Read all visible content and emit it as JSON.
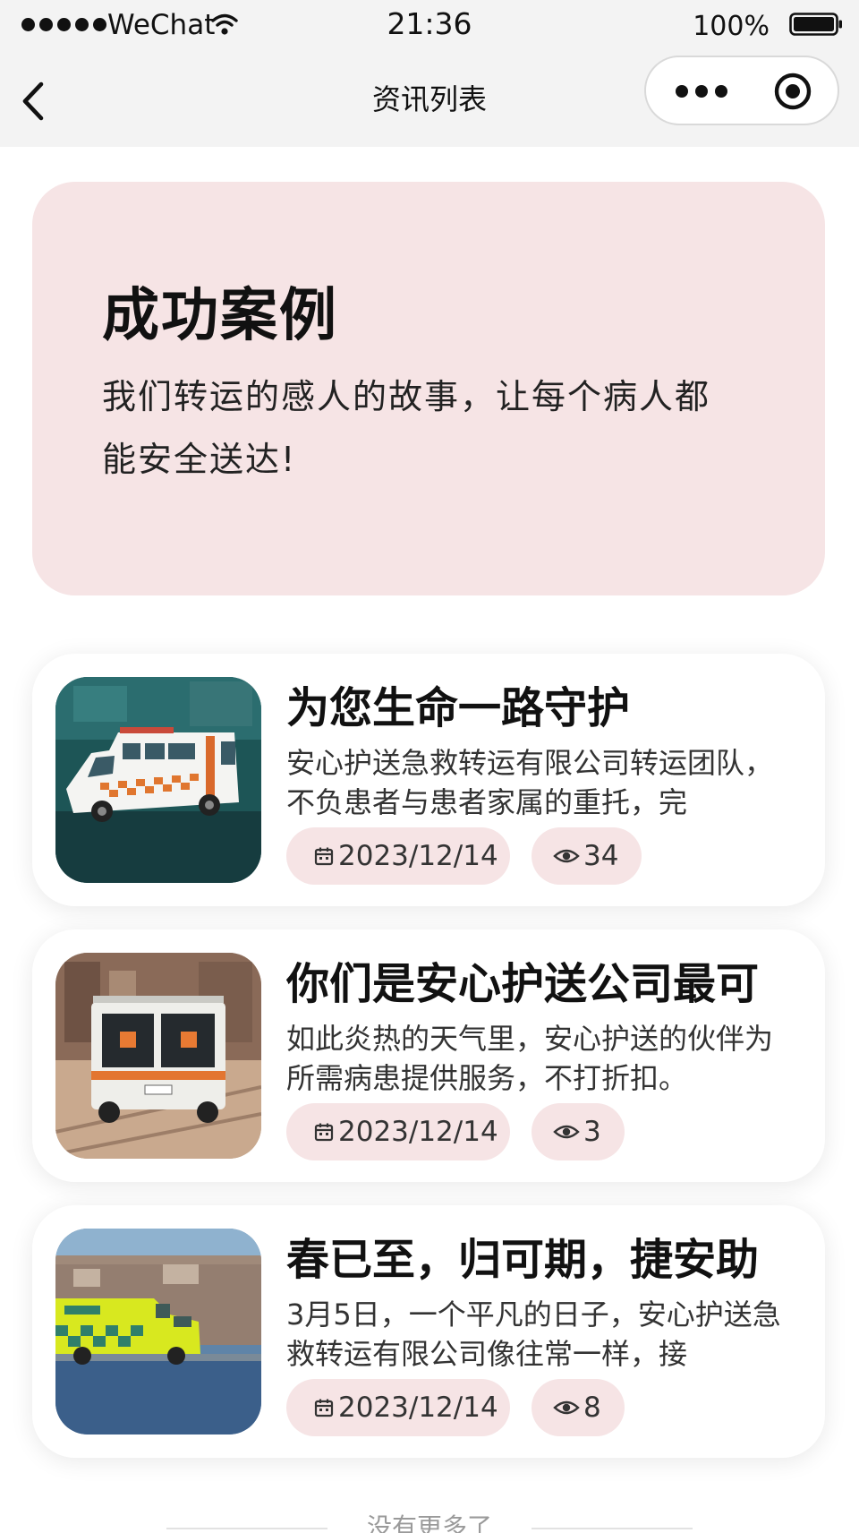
{
  "status_bar": {
    "carrier": "WeChat",
    "time": "21:36",
    "battery": "100%"
  },
  "nav": {
    "title": "资讯列表",
    "back_icon": "chevron-left-icon",
    "more_icon": "more-dots-icon",
    "close_icon": "target-circle-icon"
  },
  "hero": {
    "title": "成功案例",
    "description": "我们转运的感人的故事，让每个病人都能安全送达!",
    "background": "#f6e4e5"
  },
  "news": [
    {
      "title": "为您生命一路守护",
      "summary": "安心护送急救转运有限公司转运团队，不负患者与患者家属的重托，完",
      "date": "2023/12/14",
      "views": "34",
      "image": "ambulance-photo"
    },
    {
      "title": "你们是安心护送公司最可",
      "summary": "如此炎热的天气里，安心护送的伙伴为所需病患提供服务，不打折扣。",
      "date": "2023/12/14",
      "views": "3",
      "image": "ambulance-street-photo"
    },
    {
      "title": "春已至，归可期，捷安助",
      "summary": "3月5日，一个平凡的日子，安心护送急救转运有限公司像往常一样，接",
      "date": "2023/12/14",
      "views": "8",
      "image": "ambulance-motion-photo"
    }
  ],
  "footer": {
    "text": "没有更多了"
  },
  "colors": {
    "accent_pink": "#f6e4e5",
    "nav_background": "#f3f3f3",
    "text_primary": "#111111"
  }
}
